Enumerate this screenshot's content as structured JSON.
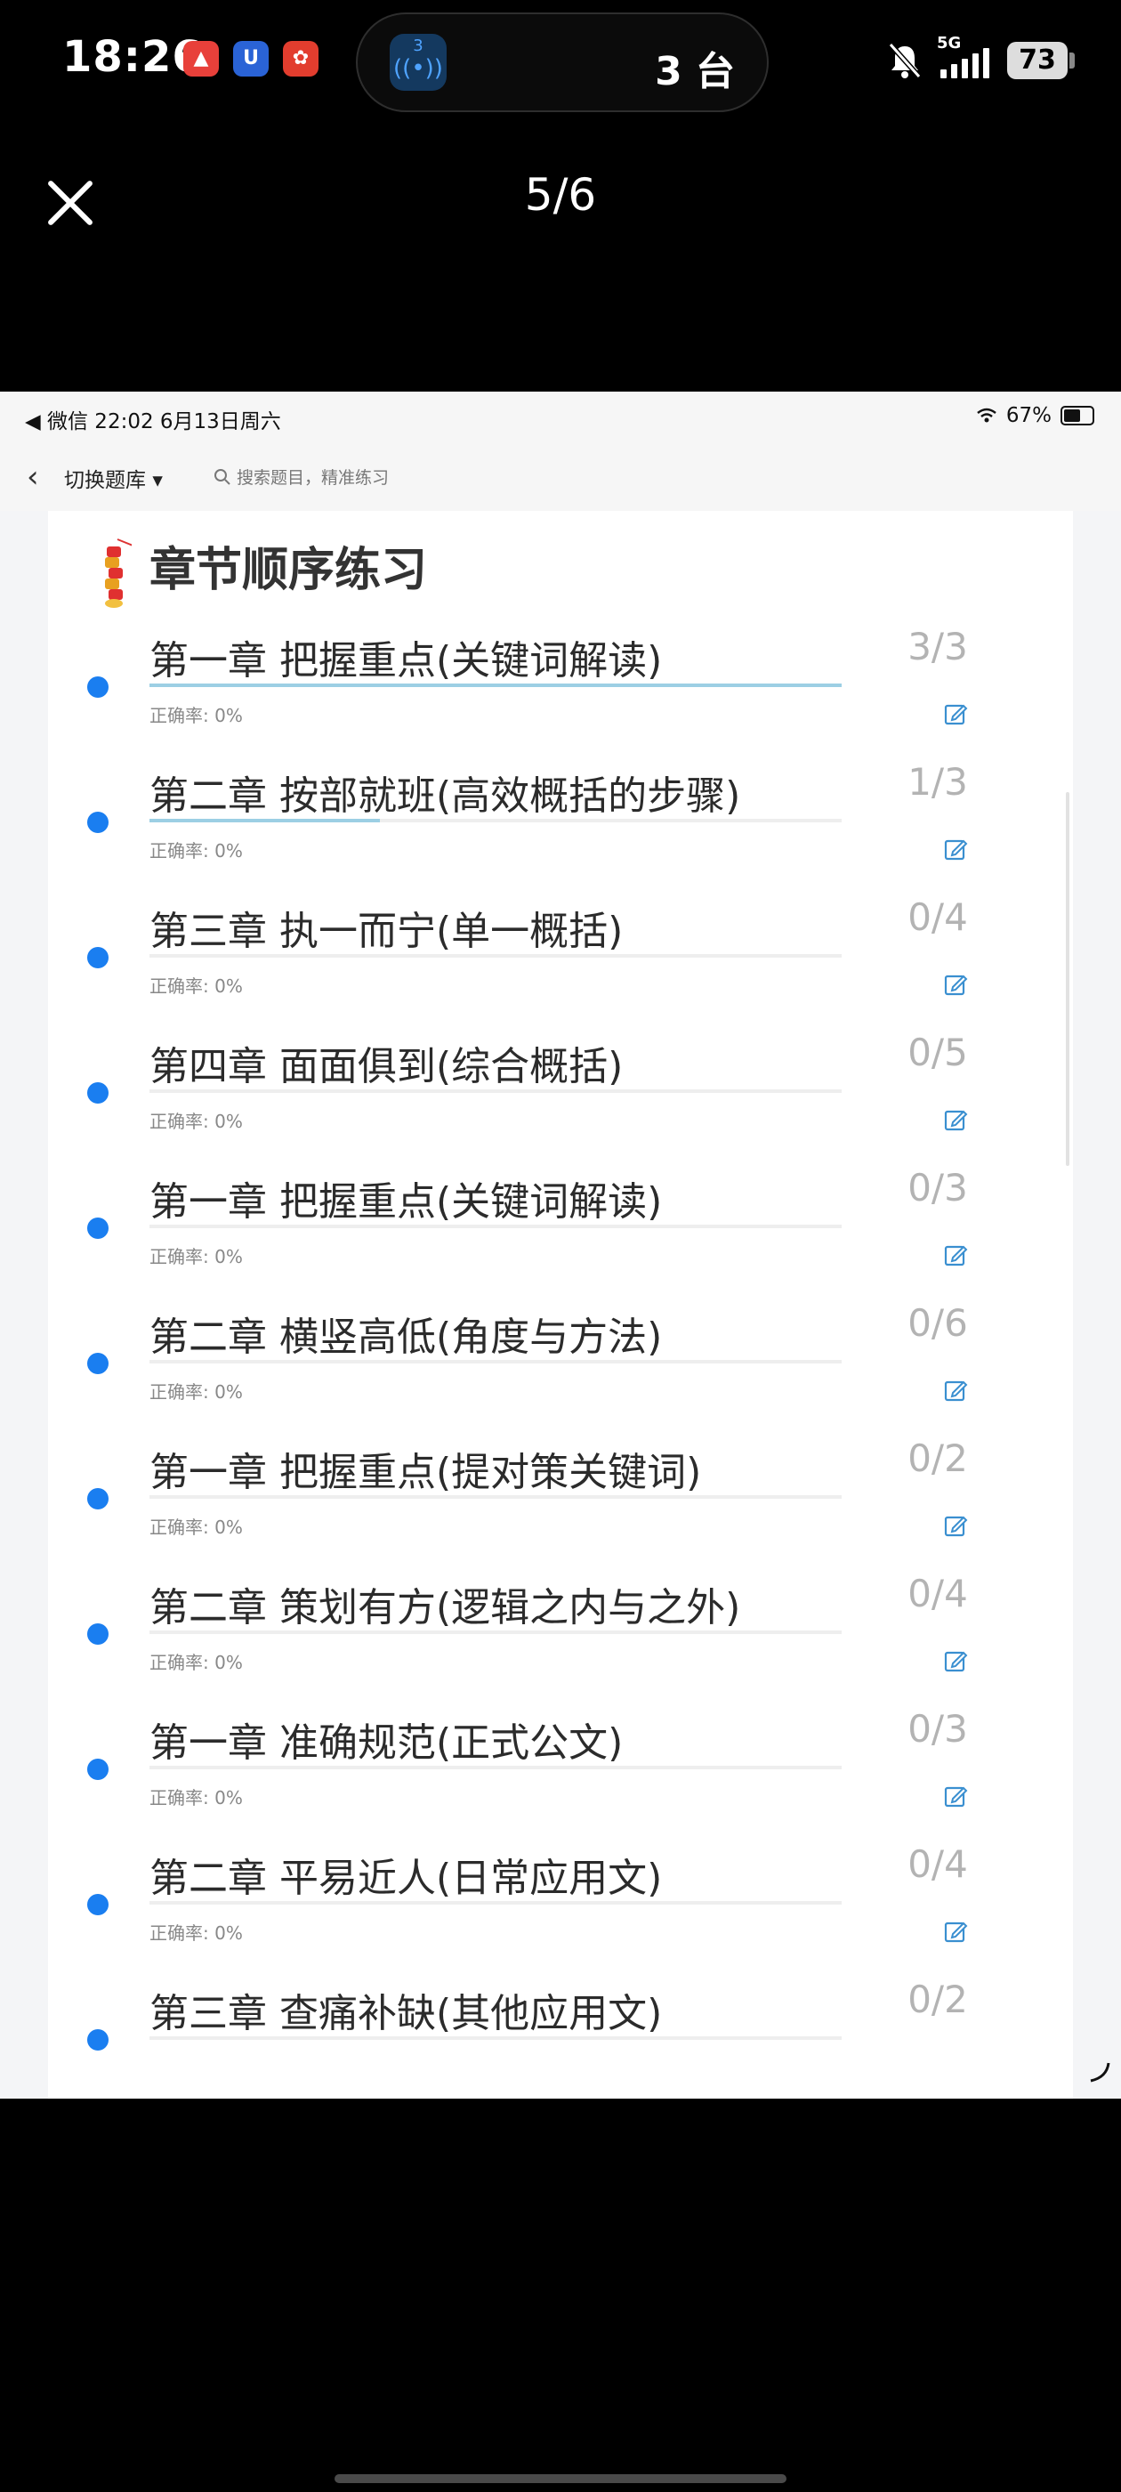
{
  "status_bar": {
    "time": "18:26",
    "app_icons": [
      {
        "name": "red-app-icon",
        "color": "#e8403a",
        "glyph": "▲"
      },
      {
        "name": "blue-app-icon",
        "color": "#2a63d6",
        "glyph": "U"
      },
      {
        "name": "meituan-app-icon",
        "color": "#e23d2e",
        "glyph": "✿"
      }
    ],
    "island_badge": "3",
    "island_text": "3 台",
    "network": "5G",
    "battery": "73"
  },
  "viewer": {
    "page_indicator": "5/6"
  },
  "inner_status": {
    "left": "◀ 微信   22:02   6月13日周六",
    "battery_pct": "67%"
  },
  "nav": {
    "back_label": "‹",
    "switch_label": "切换题库",
    "search_placeholder": "搜索题目，精准练习"
  },
  "section_title": "章节顺序练习",
  "accent_color": "#1a7ef0",
  "chapters": [
    {
      "title": "第一章 把握重点(关键词解读)",
      "progress": "3/3",
      "fraction": 1.0,
      "accuracy_label": "正确率: 0%"
    },
    {
      "title": "第二章 按部就班(高效概括的步骤)",
      "progress": "1/3",
      "fraction": 0.3333,
      "accuracy_label": "正确率: 0%"
    },
    {
      "title": "第三章 执一而宁(单一概括)",
      "progress": "0/4",
      "fraction": 0,
      "accuracy_label": "正确率: 0%"
    },
    {
      "title": "第四章 面面俱到(综合概括)",
      "progress": "0/5",
      "fraction": 0,
      "accuracy_label": "正确率: 0%"
    },
    {
      "title": "第一章 把握重点(关键词解读)",
      "progress": "0/3",
      "fraction": 0,
      "accuracy_label": "正确率: 0%"
    },
    {
      "title": "第二章 横竖高低(角度与方法)",
      "progress": "0/6",
      "fraction": 0,
      "accuracy_label": "正确率: 0%"
    },
    {
      "title": "第一章 把握重点(提对策关键词)",
      "progress": "0/2",
      "fraction": 0,
      "accuracy_label": "正确率: 0%"
    },
    {
      "title": "第二章 策划有方(逻辑之内与之外)",
      "progress": "0/4",
      "fraction": 0,
      "accuracy_label": "正确率: 0%"
    },
    {
      "title": "第一章 准确规范(正式公文)",
      "progress": "0/3",
      "fraction": 0,
      "accuracy_label": "正确率: 0%"
    },
    {
      "title": "第二章 平易近人(日常应用文)",
      "progress": "0/4",
      "fraction": 0,
      "accuracy_label": "正确率: 0%"
    },
    {
      "title": "第三章 查痛补缺(其他应用文)",
      "progress": "0/2",
      "fraction": 0,
      "accuracy_label": ""
    }
  ]
}
